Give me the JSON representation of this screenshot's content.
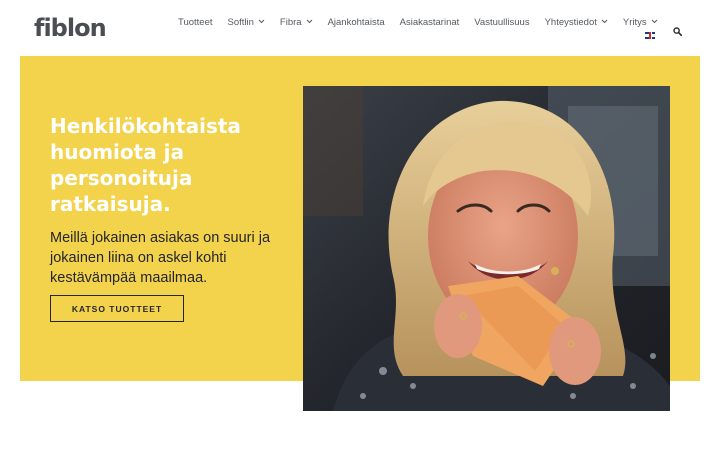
{
  "header": {
    "logo_text": "fiblon",
    "nav": [
      {
        "label": "Tuotteet",
        "dropdown": false
      },
      {
        "label": "Softlin",
        "dropdown": true
      },
      {
        "label": "Fibra",
        "dropdown": true
      },
      {
        "label": "Ajankohtaista",
        "dropdown": false
      },
      {
        "label": "Asiakastarinat",
        "dropdown": false
      },
      {
        "label": "Vastuullisuus",
        "dropdown": false
      },
      {
        "label": "Yhteystiedot",
        "dropdown": true
      },
      {
        "label": "Yritys",
        "dropdown": true
      }
    ],
    "language_icon": "uk-flag-icon",
    "search_icon": "search-icon"
  },
  "hero": {
    "title": "Henkilökohtaista huomiota ja personoituja ratkaisuja.",
    "text": "Meillä jokainen asiakas on suuri ja jokainen liina on askel kohti kestävämpää maailmaa.",
    "cta_label": "KATSO TUOTTEET",
    "background_color": "#f3d24c",
    "image_subject": "smiling-woman-with-orange-cloth"
  }
}
